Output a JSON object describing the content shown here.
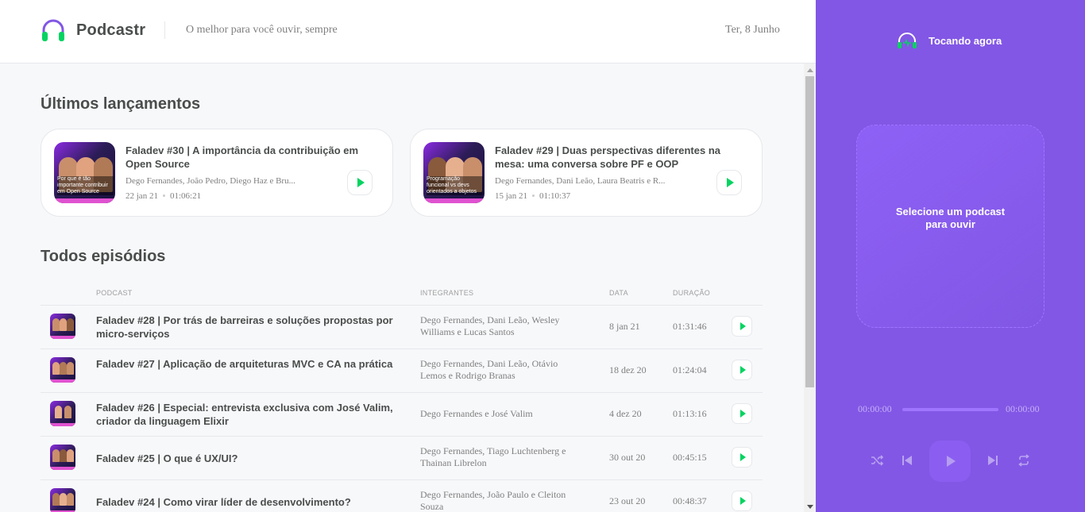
{
  "header": {
    "app_name": "Podcastr",
    "tagline": "O melhor para você ouvir, sempre",
    "date": "Ter, 8 Junho"
  },
  "latest": {
    "title": "Últimos lançamentos",
    "cards": [
      {
        "title": "Faladev #30 | A importância da contribuição em Open Source",
        "members": "Dego Fernandes, João Pedro, Diego Haz e Bru...",
        "date": "22 jan 21",
        "duration": "01:06:21",
        "thumb_caption": "Por que é tão importante contribuir em Open Source",
        "thumb_number": "4"
      },
      {
        "title": "Faladev #29 | Duas perspectivas diferentes na mesa: uma conversa sobre PF e OOP",
        "members": "Dego Fernandes, Dani Leão, Laura Beatris e R...",
        "date": "15 jan 21",
        "duration": "01:10:37",
        "thumb_caption": "Programação funcional vs devs orientados a objetos",
        "thumb_number": "3"
      }
    ]
  },
  "all": {
    "title": "Todos episódios",
    "columns": [
      "Podcast",
      "Integrantes",
      "Data",
      "Duração"
    ],
    "rows": [
      {
        "title": "Faladev #28 | Por trás de barreiras e soluções propostas por micro-serviços",
        "members": "Dego Fernandes, Dani Leão, Wesley Williams e Lucas Santos",
        "date": "8 jan 21",
        "duration": "01:31:46"
      },
      {
        "title": "Faladev #27 | Aplicação de arquiteturas MVC e CA na prática",
        "members": "Dego Fernandes, Dani Leão, Otávio Lemos e Rodrigo Branas",
        "date": "18 dez 20",
        "duration": "01:24:04"
      },
      {
        "title": "Faladev #26 | Especial: entrevista exclusiva com José Valim, criador da linguagem Elixir",
        "members": "Dego Fernandes e José Valim",
        "date": "4 dez 20",
        "duration": "01:13:16"
      },
      {
        "title": "Faladev #25 | O que é UX/UI?",
        "members": "Dego Fernandes, Tiago Luchtenberg e Thainan Librelon",
        "date": "30 out 20",
        "duration": "00:45:15"
      },
      {
        "title": "Faladev #24 | Como virar líder de desenvolvimento?",
        "members": "Dego Fernandes, João Paulo e Cleiton Souza",
        "date": "23 out 20",
        "duration": "00:48:37"
      }
    ]
  },
  "player": {
    "heading": "Tocando agora",
    "empty_message": "Selecione um podcast para ouvir",
    "current_time": "00:00:00",
    "total_time": "00:00:00",
    "progress": 0
  },
  "colors": {
    "brand": "#8257e5",
    "play_green": "#04d361",
    "text": "#494d4b",
    "muted": "#808080"
  }
}
